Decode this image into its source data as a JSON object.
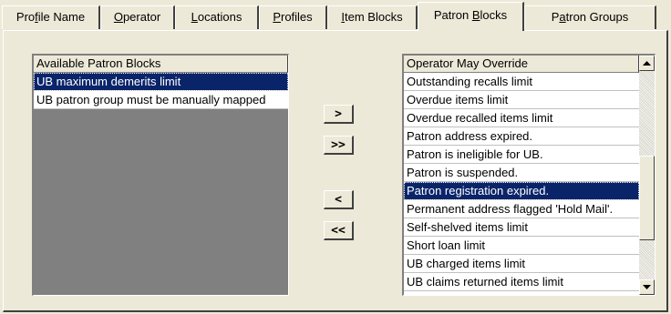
{
  "tabs": [
    {
      "label": "Profile Name",
      "accel": "f",
      "active": false
    },
    {
      "label": "Operator",
      "accel": "O",
      "active": false
    },
    {
      "label": "Locations",
      "accel": "L",
      "active": false
    },
    {
      "label": "Profiles",
      "accel": "P",
      "active": false
    },
    {
      "label": "Item Blocks",
      "accel": "I",
      "active": false
    },
    {
      "label": "Patron Blocks",
      "accel": "B",
      "active": true
    },
    {
      "label": "Patron Groups",
      "accel": "a",
      "active": false
    }
  ],
  "available_list": {
    "header": "Available Patron Blocks",
    "items": [
      {
        "label": "UB maximum demerits limit",
        "selected": true
      },
      {
        "label": "UB patron group must be manually mapped",
        "selected": false
      }
    ]
  },
  "buttons": {
    "add": ">",
    "add_all": ">>",
    "remove": "<",
    "remove_all": "<<"
  },
  "override_list": {
    "header": "Operator May Override",
    "items": [
      {
        "label": "Outstanding recalls limit",
        "selected": false
      },
      {
        "label": "Overdue items limit",
        "selected": false
      },
      {
        "label": "Overdue recalled items limit",
        "selected": false
      },
      {
        "label": "Patron address expired.",
        "selected": false
      },
      {
        "label": "Patron is ineligible for UB.",
        "selected": false
      },
      {
        "label": "Patron is suspended.",
        "selected": false
      },
      {
        "label": "Patron registration expired.",
        "selected": true
      },
      {
        "label": "Permanent address flagged 'Hold Mail'.",
        "selected": false
      },
      {
        "label": "Self-shelved items limit",
        "selected": false
      },
      {
        "label": "Short loan limit",
        "selected": false
      },
      {
        "label": "UB charged items limit",
        "selected": false
      },
      {
        "label": "UB claims returned items limit",
        "selected": false
      }
    ]
  },
  "scrollbar": {
    "up_icon": "triangle-up",
    "down_icon": "triangle-down"
  },
  "colors": {
    "selection": "#0a246a",
    "face": "#ece9d8",
    "list_background": "#808080"
  }
}
